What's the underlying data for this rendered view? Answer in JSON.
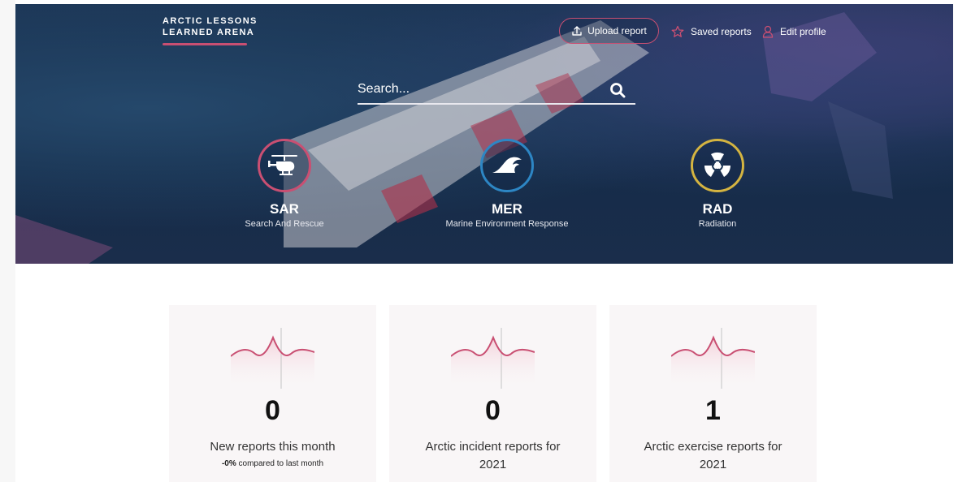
{
  "header": {
    "brand_line1": "ARCTIC LESSONS",
    "brand_line2": "LEARNED ARENA",
    "upload_label": "Upload report",
    "saved_label": "Saved reports",
    "edit_label": "Edit profile"
  },
  "search": {
    "placeholder": "Search..."
  },
  "categories": [
    {
      "abbr": "SAR",
      "name": "Search And Rescue",
      "icon": "helicopter-icon",
      "color": "#c94f72"
    },
    {
      "abbr": "MER",
      "name": "Marine Environment Response",
      "icon": "wave-icon",
      "color": "#2d86c4"
    },
    {
      "abbr": "RAD",
      "name": "Radiation",
      "icon": "radiation-icon",
      "color": "#d4b441"
    }
  ],
  "stats": [
    {
      "value": "0",
      "label": "New reports this month",
      "sub_bold": "-0%",
      "sub_rest": " compared to last month"
    },
    {
      "value": "0",
      "label": "Arctic incident reports for 2021"
    },
    {
      "value": "1",
      "label": "Arctic exercise reports for 2021"
    }
  ],
  "colors": {
    "accent": "#c94f72",
    "hero_bg": "#1c3656",
    "card_bg": "#f9f6f7"
  }
}
